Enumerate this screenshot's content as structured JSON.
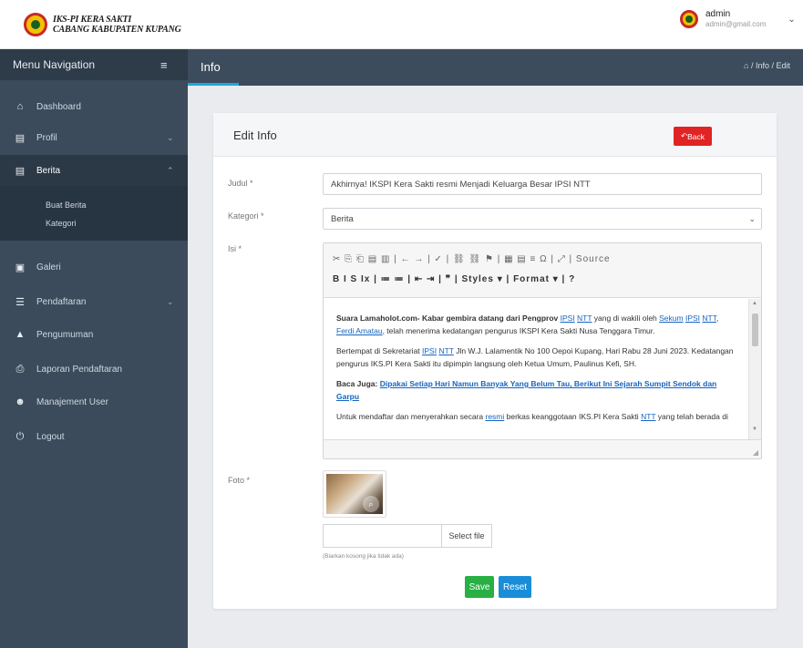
{
  "brand": {
    "line1": "IKS-PI KERA SAKTI",
    "line2": "CABANG KABUPATEN KUPANG"
  },
  "user": {
    "name": "admin",
    "email": "admin@gmail.com"
  },
  "sidebar": {
    "heading": "Menu Navigation",
    "items": [
      {
        "label": "Dashboard",
        "icon": "home-icon"
      },
      {
        "label": "Profil",
        "icon": "document-icon",
        "has_arrow": true
      },
      {
        "label": "Berita",
        "icon": "document-icon",
        "has_arrow": true,
        "expanded": true
      },
      {
        "label": "Galeri",
        "icon": "image-icon"
      },
      {
        "label": "Pendaftaran",
        "icon": "list-icon",
        "has_arrow": true
      },
      {
        "label": "Pengumuman",
        "icon": "warning-icon"
      },
      {
        "label": "Laporan Pendaftaran",
        "icon": "print-icon"
      },
      {
        "label": "Manajement User",
        "icon": "users-icon"
      },
      {
        "label": "Logout",
        "icon": "power-icon"
      }
    ],
    "submenu": [
      "Buat Berita",
      "Kategori"
    ]
  },
  "page": {
    "title": "Info",
    "breadcrumb": "/ Info / Edit"
  },
  "card": {
    "title": "Edit Info",
    "back_label": "Back",
    "judul_label": "Judul *",
    "judul_value": "Akhirnya! IKSPI Kera Sakti resmi Menjadi Keluarga Besar IPSI NTT",
    "kategori_label": "Kategori *",
    "kategori_value": "Berita",
    "isi_label": "Isi *",
    "toolbar_row1": "✂ ⎘ ⎗ ▤ ▥ | ← → | ✓ | ⛓ ⛓ ⚑ | ▦ ▤ ≡ Ω | ⤢ | Source",
    "toolbar_row2": "B I S Ix | ≔ ≔ | ⇤ ⇥ | ❞ | Styles ▾ | Format ▾ | ?",
    "source_label": "Source",
    "styles_label": "Styles",
    "format_label": "Format",
    "content": {
      "p1_a": "Suara Lamaholot.com- Kabar gembira datang dari Pengprov ",
      "p1_link1": "IPSI",
      "p1_link2": "NTT",
      "p1_b": " yang di wakili oleh ",
      "p1_link3": "Sekum",
      "p1_link4": "IPSI",
      "p1_link5": "NTT",
      "p1_c": ", ",
      "p1_link6": "Ferdi Amatau",
      "p1_d": ", telah menerima kedatangan pengurus IKSPI Kera Sakti Nusa Tenggara Timur.",
      "p2_a": "Bertempat di Sekretariat ",
      "p2_link1": "IPSI",
      "p2_link2": "NTT",
      "p2_b": " Jln W.J. Lalamentik No 100 Oepoi Kupang, Hari Rabu 28 Juni 2023. Kedatangan pengurus IKS.PI Kera Sakti itu dipimpin langsung oleh Ketua Umum, Paulinus Kefi, SH.",
      "p3_a": "Baca Juga: ",
      "p3_link": "Dipakai Setiap Hari Namun Banyak Yang Belum Tau, Berikut Ini Sejarah Sumpit Sendok dan Garpu",
      "p4_a": "Untuk mendaftar dan menyerahkan secara ",
      "p4_link1": "resmi",
      "p4_b": " berkas keanggotaan IKS.PI Kera Sakti ",
      "p4_link2": "NTT",
      "p4_c": " yang telah berada di"
    },
    "foto_label": "Foto *",
    "select_file_label": "Select file",
    "hint": "(Biarkan kosong jika tidak ada)",
    "save_label": "Save",
    "reset_label": "Reset"
  },
  "colors": {
    "sidebar": "#3b4b5b",
    "back": "#e02424",
    "save": "#28b044",
    "reset": "#1a8dd8",
    "accent": "#1ea7e0"
  }
}
